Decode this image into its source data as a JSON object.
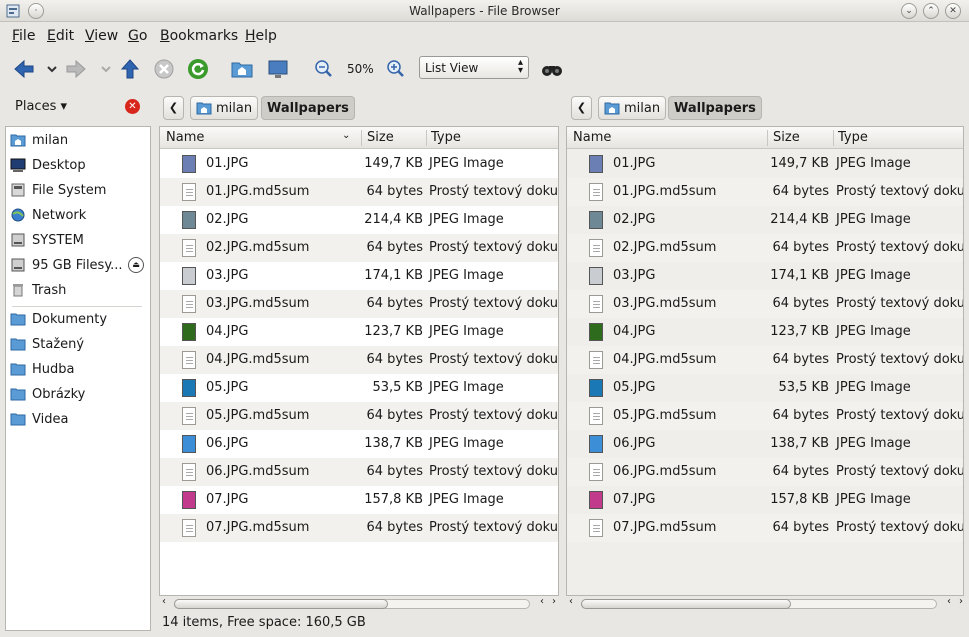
{
  "window": {
    "title": "Wallpapers - File Browser"
  },
  "menubar": [
    {
      "u": "F",
      "rest": "ile"
    },
    {
      "u": "E",
      "rest": "dit"
    },
    {
      "u": "V",
      "rest": "iew"
    },
    {
      "u": "G",
      "rest": "o"
    },
    {
      "u": "B",
      "rest": "ookmarks"
    },
    {
      "u": "H",
      "rest": "elp"
    }
  ],
  "toolbar": {
    "zoom": "50%",
    "view_mode": "List View"
  },
  "places": {
    "header": "Places",
    "items": [
      "milan",
      "Desktop",
      "File System",
      "Network",
      "SYSTEM",
      "95 GB Filesy...",
      "Trash"
    ],
    "bookmarks": [
      "Dokumenty",
      "Stažený",
      "Hudba",
      "Obrázky",
      "Videa"
    ]
  },
  "left_pane": {
    "crumbs": [
      "milan",
      "Wallpapers"
    ]
  },
  "right_pane": {
    "crumbs": [
      "milan",
      "Wallpapers"
    ]
  },
  "columns": {
    "name": "Name",
    "size": "Size",
    "type": "Type"
  },
  "files": [
    {
      "name": "01.JPG",
      "size": "149,7 KB",
      "type": "JPEG Image",
      "thumb": "#6b7fb5"
    },
    {
      "name": "01.JPG.md5sum",
      "size": "64 bytes",
      "type": "Prostý textový dokument"
    },
    {
      "name": "02.JPG",
      "size": "214,4 KB",
      "type": "JPEG Image",
      "thumb": "#6e8896"
    },
    {
      "name": "02.JPG.md5sum",
      "size": "64 bytes",
      "type": "Prostý textový dokument"
    },
    {
      "name": "03.JPG",
      "size": "174,1 KB",
      "type": "JPEG Image",
      "thumb": "#c9cdd2"
    },
    {
      "name": "03.JPG.md5sum",
      "size": "64 bytes",
      "type": "Prostý textový dokument"
    },
    {
      "name": "04.JPG",
      "size": "123,7 KB",
      "type": "JPEG Image",
      "thumb": "#2f6b1c"
    },
    {
      "name": "04.JPG.md5sum",
      "size": "64 bytes",
      "type": "Prostý textový dokument"
    },
    {
      "name": "05.JPG",
      "size": "53,5 KB",
      "type": "JPEG Image",
      "thumb": "#1a78b4"
    },
    {
      "name": "05.JPG.md5sum",
      "size": "64 bytes",
      "type": "Prostý textový dokument"
    },
    {
      "name": "06.JPG",
      "size": "138,7 KB",
      "type": "JPEG Image",
      "thumb": "#3c8fd6"
    },
    {
      "name": "06.JPG.md5sum",
      "size": "64 bytes",
      "type": "Prostý textový dokument"
    },
    {
      "name": "07.JPG",
      "size": "157,8 KB",
      "type": "JPEG Image",
      "thumb": "#c23a8c"
    },
    {
      "name": "07.JPG.md5sum",
      "size": "64 bytes",
      "type": "Prostý textový dokument"
    }
  ],
  "status": "14 items, Free space: 160,5 GB",
  "colors": {
    "accent": "#3d82c9",
    "folder": "#5b9bd5",
    "selected_crumb": "#cfcdc7"
  }
}
